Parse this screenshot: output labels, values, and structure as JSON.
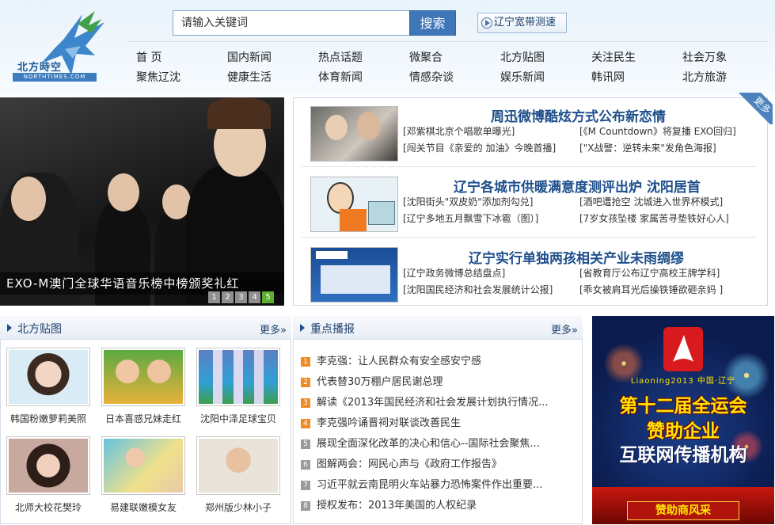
{
  "site": {
    "logo_text": "北方時空",
    "logo_sub": "NORTHTIMES.COM"
  },
  "search": {
    "placeholder": "请输入关键词",
    "button_label": "搜索"
  },
  "speed_test": {
    "label": "辽宁宽带测速"
  },
  "nav": {
    "row1": [
      "首 页",
      "国内新闻",
      "热点话题",
      "微聚合",
      "北方贴图",
      "关注民生",
      "社会万象"
    ],
    "row2": [
      "聚焦辽沈",
      "健康生活",
      "体育新闻",
      "情感杂谈",
      "娱乐新闻",
      "韩讯网",
      "北方旅游"
    ]
  },
  "slideshow": {
    "caption": "EXO-M澳门全球华语音乐榜中榜颁奖礼红",
    "pages": [
      "1",
      "2",
      "3",
      "4",
      "5"
    ],
    "active_page": "5"
  },
  "news": {
    "more_label": "更多",
    "blocks": [
      {
        "title": "周迅微博酷炫方式公布新恋情",
        "links": [
          "[邓紫棋北京个唱歌单曝光]",
          "[《M Countdown》将复播 EXO回归]",
          "[闯关节目《亲爱的 加油》今晚首播]",
          "[\"X战警：逆转未来\"发角色海报]"
        ]
      },
      {
        "title": "辽宁各城市供暖满意度测评出炉 沈阳居首",
        "links": [
          "[沈阳街头\"双皮奶\"添加剂勾兑]",
          "[酒吧遭抢空 沈城进入世界杯模式]",
          "[辽宁多地五月飘雪下冰雹（图）]",
          "[7岁女孩坠楼 家属苦寻垫铁好心人]"
        ]
      },
      {
        "title": "辽宁实行单独两孩相关产业未雨绸缪",
        "links": [
          "[辽宁政务微博总结盘点]",
          "[省教育厅公布辽宁高校王牌学科]",
          "[沈阳国民经济和社会发展统计公报]",
          "[乖女被肩耳光后操铁锤欲砸亲妈 ]"
        ]
      }
    ]
  },
  "photos": {
    "title": "北方贴图",
    "more_label": "更多»",
    "items": [
      {
        "caption": "韩国粉嫩萝莉美照",
        "icon": "girl-portrait-photo"
      },
      {
        "caption": "日本喜感兄妹走红",
        "icon": "kids-photo"
      },
      {
        "caption": "沈阳中泽足球宝贝",
        "icon": "football-babes-photo"
      },
      {
        "caption": "北师大校花樊玲",
        "icon": "student-portrait-photo"
      },
      {
        "caption": "易建联嫩模女友",
        "icon": "model-photo"
      },
      {
        "caption": "郑州版少林小子",
        "icon": "shaolin-kid-photo"
      }
    ]
  },
  "focus": {
    "title": "重点播报",
    "more_label": "更多»",
    "items": [
      {
        "num": "1",
        "text": "李克强：让人民群众有安全感安宁感",
        "hot": true
      },
      {
        "num": "2",
        "text": "代表替30万棚户居民谢总理",
        "hot": true
      },
      {
        "num": "3",
        "text": "解读《2013年国民经济和社会发展计划执行情况...",
        "hot": true
      },
      {
        "num": "4",
        "text": "李克强吟诵晋祠对联谈改善民生",
        "hot": true
      },
      {
        "num": "5",
        "text": "展现全面深化改革的决心和信心--国际社会聚焦...",
        "hot": false
      },
      {
        "num": "6",
        "text": "图解两会：网民心声与《政府工作报告》",
        "hot": false
      },
      {
        "num": "7",
        "text": "习近平就云南昆明火车站暴力恐怖案件作出重要...",
        "hot": false
      },
      {
        "num": "8",
        "text": "授权发布：2013年美国的人权纪录",
        "hot": false
      }
    ]
  },
  "ad": {
    "brand": "Liaoning2013 中国·辽宁",
    "line1": "第十二届全运会",
    "line2": "赞助企业",
    "line3": "互联网传播机构",
    "banner": "赞助商风采"
  },
  "colors": {
    "accent": "#1e4f8c",
    "search_button": "#3e76b8",
    "pager_active": "#5cae2c",
    "hot_num": "#f08a24"
  }
}
